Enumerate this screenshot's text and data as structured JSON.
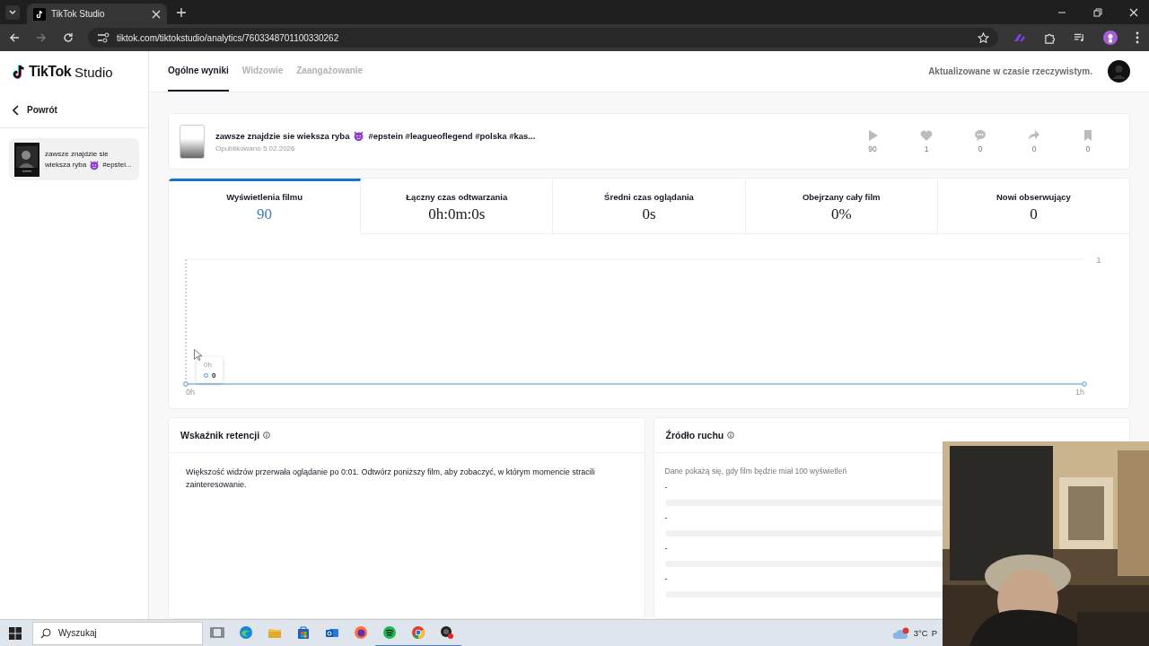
{
  "browser": {
    "tab_title": "TikTok Studio",
    "url": "tiktok.com/tiktokstudio/analytics/7603348701100330262"
  },
  "header": {
    "logo_word": "TikTok",
    "logo_suffix": "Studio",
    "tabs": [
      {
        "label": "Ogólne wyniki",
        "selected": true
      },
      {
        "label": "Widzowie",
        "selected": false
      },
      {
        "label": "Zaangażowanie",
        "selected": false
      }
    ],
    "status": "Aktualizowane w czasie rzeczywistym."
  },
  "sidebar": {
    "back": "Powrót",
    "items": [
      {
        "title_start": "zawsze znajdzie sie",
        "title_rest": "wieksza ryba",
        "title_end": "#epstei...",
        "selected": true
      }
    ]
  },
  "video": {
    "title_start": "zawsze znajdzie sie wieksza ryba",
    "title_end": "#epstein #leagueoflegend #polska #kas...",
    "published": "Opublikowano 5.02.2026",
    "stats": [
      {
        "kind": "play",
        "value": "90"
      },
      {
        "kind": "like",
        "value": "1"
      },
      {
        "kind": "comment",
        "value": "0"
      },
      {
        "kind": "share",
        "value": "0"
      },
      {
        "kind": "save",
        "value": "0"
      }
    ]
  },
  "metrics": [
    {
      "label": "Wyświetlenia filmu",
      "value": "90",
      "selected": true
    },
    {
      "label": "Łączny czas odtwarzania",
      "value": "0h:0m:0s",
      "selected": false
    },
    {
      "label": "Średni czas oglądania",
      "value": "0s",
      "selected": false
    },
    {
      "label": "Obejrzany cały film",
      "value": "0%",
      "selected": false
    },
    {
      "label": "Nowi obserwujący",
      "value": "0",
      "selected": false
    }
  ],
  "chart": {
    "x_labels": [
      "0h",
      "1h"
    ],
    "y_label": "1",
    "tooltip": {
      "label": "0h",
      "value": "0"
    }
  },
  "retention": {
    "title": "Wskaźnik retencji",
    "text": "Większość widzów przerwała oglądanie po 0:01. Odtwórz poniższy film, aby zobaczyć, w którym momencie stracili zainteresowanie."
  },
  "traffic": {
    "title": "Źródło ruchu",
    "note": "Dane pokażą się, gdy film będzie miał 100 wyświetleń",
    "rows": [
      "-",
      "-",
      "-",
      "-"
    ]
  },
  "taskbar": {
    "search_placeholder": "Wyszukaj",
    "weather": "3°C",
    "weather_more": "P"
  }
}
